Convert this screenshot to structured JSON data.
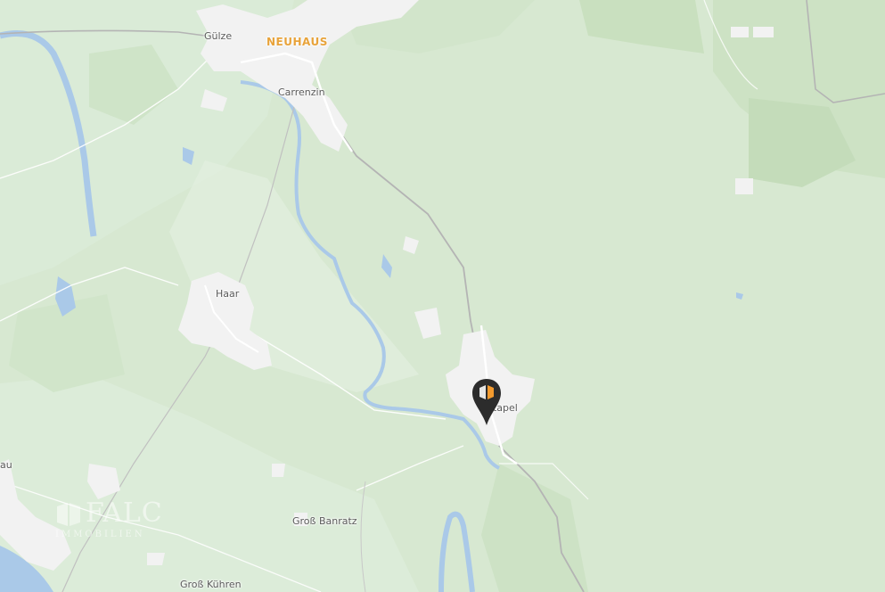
{
  "map": {
    "places": [
      {
        "name": "Gülze",
        "type": "village"
      },
      {
        "name": "NEUHAUS",
        "type": "town"
      },
      {
        "name": "Carrenzin",
        "type": "village"
      },
      {
        "name": "Haar",
        "type": "village"
      },
      {
        "name": "Stapel",
        "type": "village"
      },
      {
        "name": "Groß Banratz",
        "type": "village"
      },
      {
        "name": "Groß Kühren",
        "type": "village"
      },
      {
        "name": "au",
        "type": "village-partial"
      }
    ],
    "colors": {
      "forest_light": "#d7e8d1",
      "forest_dark": "#c4deb9",
      "field": "#e6f0e2",
      "water": "#aac9e8",
      "settlement": "#f2f2f2",
      "road": "#ffffff",
      "railway": "#b4b4b4",
      "major_label": "#e8a33a",
      "marker": "#2c2c2c",
      "marker_accent": "#f29a2e"
    },
    "marker": {
      "icon": "map-pin-icon",
      "label": "Stapel"
    },
    "watermark": {
      "brand": "FALC",
      "tagline": "IMMOBILIEN"
    }
  }
}
